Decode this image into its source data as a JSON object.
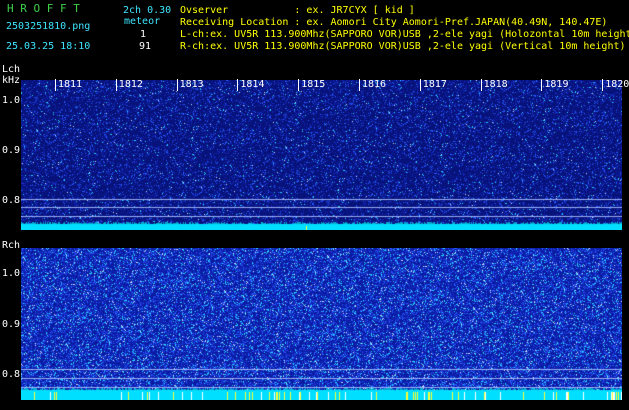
{
  "header": {
    "app_title": "H R O F F T",
    "version": "2ch 0.30",
    "filename": "2503251810.png",
    "datetime": "25.03.25 18:10",
    "event_label": "meteor",
    "lch_count": "1",
    "rch_count": "91",
    "observer_line": "Ovserver           : ex. JR7CYX [ kid ]",
    "location_line": "Receiving Location : ex. Aomori City Aomori-Pref.JAPAN(40.49N, 140.47E)",
    "lch_line": "L-ch:ex. UV5R 113.900Mhz(SAPPORO VOR)USB ,2-ele yagi (Holozontal 10m height)",
    "rch_line": "R-ch:ex. UV5R 113.900Mhz(SAPPORO VOR)USB ,2-ele yagi (Vertical 10m height)"
  },
  "time_axis": {
    "labels": [
      "1811",
      "1812",
      "1813",
      "1814",
      "1815",
      "1816",
      "1817",
      "1818",
      "1819",
      "1820"
    ]
  },
  "lch_panel": {
    "channel_label": "Lch",
    "unit_label": "kHz",
    "y_labels": [
      "1.0",
      "0.9",
      "0.8"
    ]
  },
  "rch_panel": {
    "channel_label": "Rch",
    "y_labels": [
      "1.0",
      "0.9",
      "0.8"
    ]
  },
  "colors": {
    "title_green": "#3fd04a",
    "header_cyan": "#3ee6ff",
    "spectrum_blue": "#0a1a8c",
    "baseline_cyan": "#00e5ff",
    "meteor_yellow": "#ffff30"
  }
}
